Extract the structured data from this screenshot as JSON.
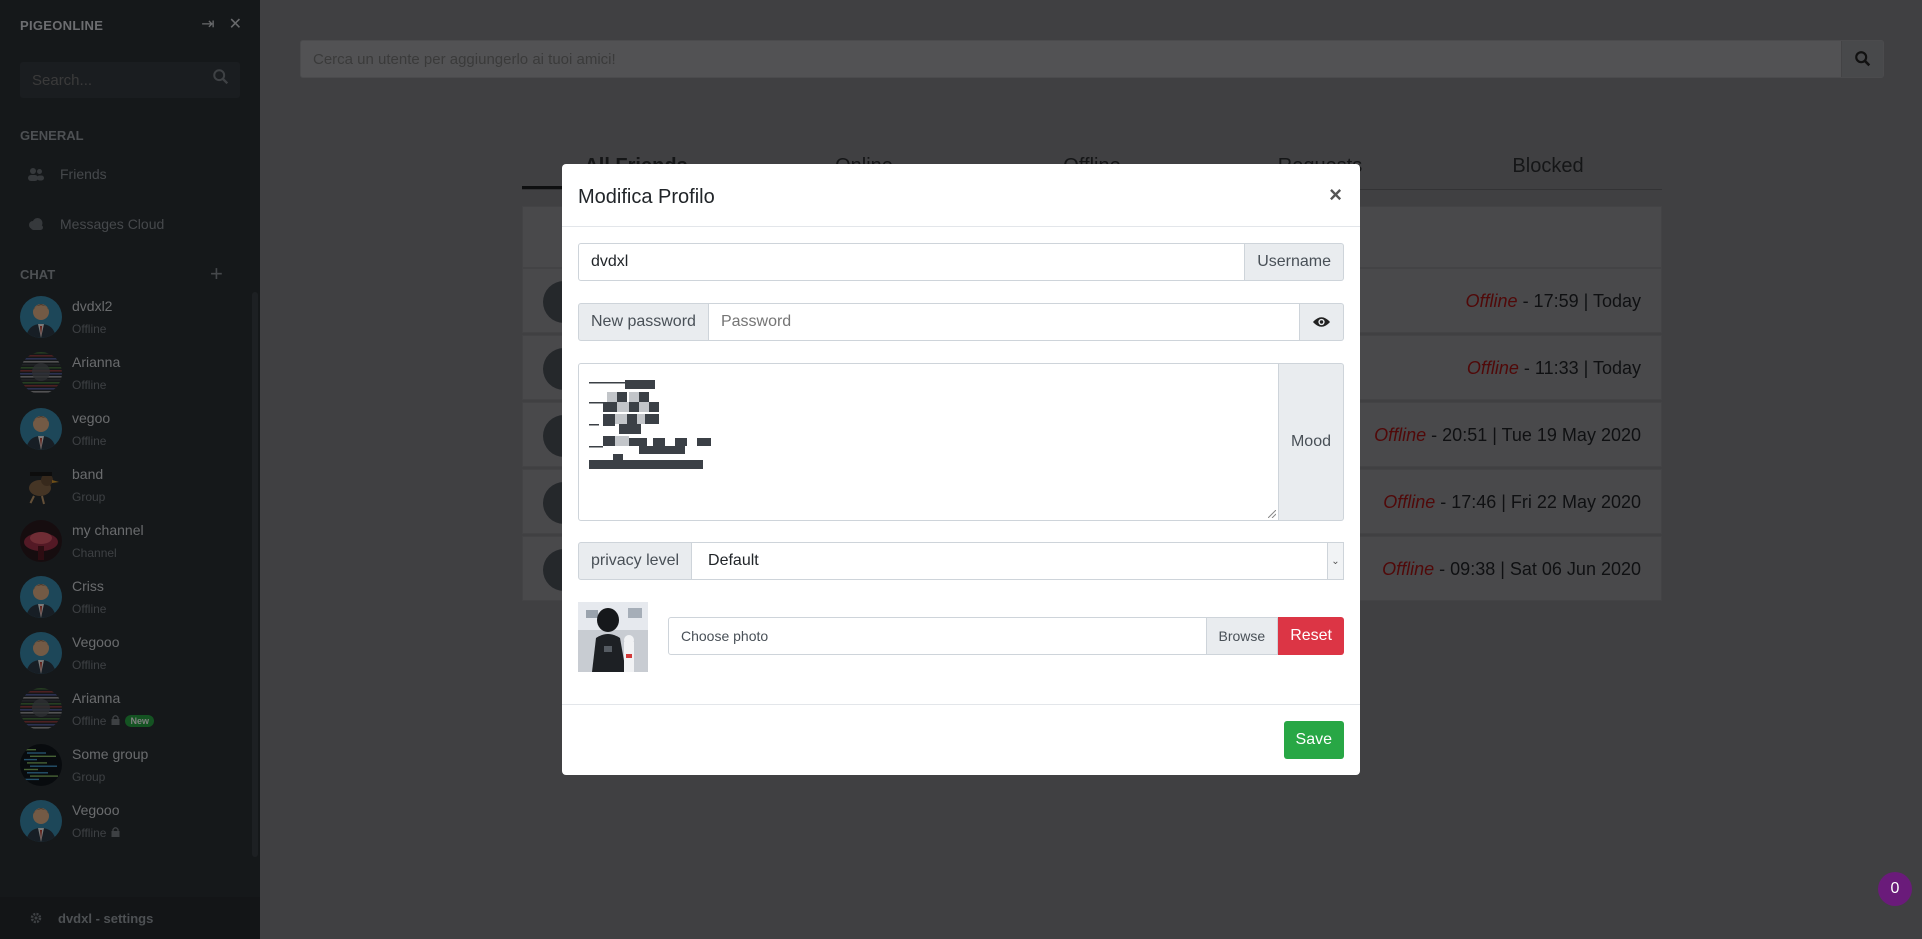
{
  "app": {
    "brand": "PIGEONLINE"
  },
  "sidebar": {
    "search_placeholder": "Search...",
    "general_label": "GENERAL",
    "nav": [
      {
        "label": "Friends",
        "icon": "users-icon"
      },
      {
        "label": "Messages Cloud",
        "icon": "cloud-icon"
      }
    ],
    "chat_label": "CHAT",
    "chats": [
      {
        "name": "dvdxl2",
        "status": "Offline",
        "avatar": "man-avatar"
      },
      {
        "name": "Arianna",
        "status": "Offline",
        "avatar": "glitch-avatar"
      },
      {
        "name": "vegoo",
        "status": "Offline",
        "avatar": "man-avatar"
      },
      {
        "name": "band",
        "status": "Group",
        "avatar": "bird-avatar"
      },
      {
        "name": "my channel",
        "status": "Channel",
        "avatar": "cloud-avatar"
      },
      {
        "name": "Criss",
        "status": "Offline",
        "avatar": "man-avatar"
      },
      {
        "name": "Vegooo",
        "status": "Offline",
        "avatar": "man-avatar"
      },
      {
        "name": "Arianna",
        "status": "Offline",
        "avatar": "glitch-avatar",
        "locked": true,
        "badge": "New"
      },
      {
        "name": "Some group",
        "status": "Group",
        "avatar": "code-avatar"
      },
      {
        "name": "Vegooo",
        "status": "Offline",
        "avatar": "man-avatar",
        "locked": true
      }
    ],
    "footer": "dvdxl - settings"
  },
  "main": {
    "search_placeholder": "Cerca un utente per aggiungerlo ai tuoi amici!",
    "tabs": [
      "All Friends",
      "Online",
      "Offline",
      "Requests",
      "Blocked"
    ],
    "friend_rows": [
      {
        "status": "Offline",
        "time": " - 17:59 | Today"
      },
      {
        "status": "Offline",
        "time": " - 11:33 | Today"
      },
      {
        "status": "Offline",
        "time": " - 20:51 | Tue 19 May 2020"
      },
      {
        "status": "Offline",
        "time": " - 17:46 | Fri 22 May 2020"
      },
      {
        "status": "Offline",
        "time": " - 09:38 | Sat 06 Jun 2020"
      }
    ],
    "notification_count": "0"
  },
  "modal": {
    "title": "Modifica Profilo",
    "close": "×",
    "username_value": "dvdxl",
    "username_label": "Username",
    "new_password_label": "New password",
    "password_placeholder": "Password",
    "mood_label": "Mood",
    "privacy_label": "privacy level",
    "privacy_value": "Default",
    "photo_placeholder": "Choose photo",
    "browse_label": "Browse",
    "reset_label": "Reset",
    "save_label": "Save"
  },
  "colors": {
    "sidebar": "#2b3035",
    "reset": "#dc3545",
    "save": "#28a745",
    "offline": "#a01313",
    "bubble": "#6a1b7a"
  }
}
